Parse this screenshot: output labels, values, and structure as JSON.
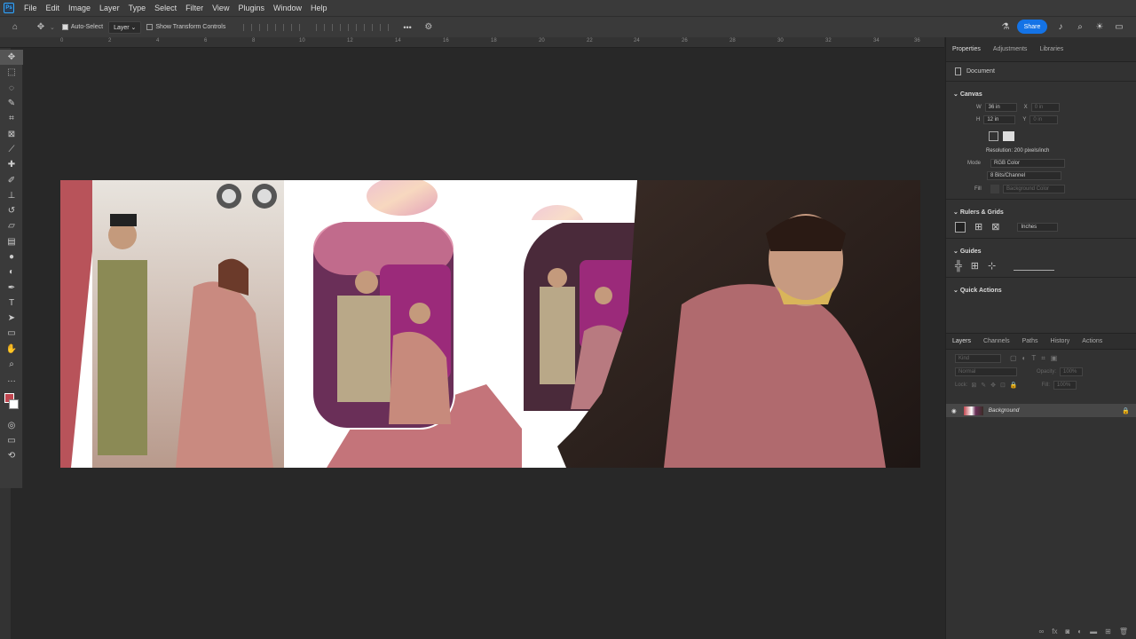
{
  "menubar": {
    "app_icon": "Ps",
    "items": [
      "File",
      "Edit",
      "Image",
      "Layer",
      "Type",
      "Select",
      "Filter",
      "View",
      "Plugins",
      "Window",
      "Help"
    ]
  },
  "options": {
    "auto_select_label": "Auto-Select",
    "auto_select_target": "Layer",
    "transform_label": "Show Transform Controls",
    "more_label": "•••",
    "share_label": "Share"
  },
  "ruler": {
    "ticks": [
      "0",
      "2",
      "4",
      "6",
      "8",
      "10",
      "12",
      "14",
      "16",
      "18",
      "20",
      "22",
      "24",
      "26",
      "28",
      "30",
      "32",
      "34",
      "36"
    ]
  },
  "panel": {
    "tabs": [
      "Properties",
      "Adjustments",
      "Libraries"
    ],
    "document_label": "Document",
    "canvas": {
      "title": "Canvas",
      "w_label": "W",
      "w_value": "36 in",
      "h_label": "H",
      "h_value": "12 in",
      "x_label": "X",
      "x_value": "0 in",
      "y_label": "Y",
      "y_value": "0 in",
      "resolution": "Resolution: 200 pixels/inch",
      "mode_label": "Mode",
      "mode_value": "RGB Color",
      "bits_value": "8 Bits/Channel",
      "fill_label": "Fill",
      "fill_value": "Background Color"
    },
    "rulers": {
      "title": "Rulers & Grids",
      "unit": "Inches"
    },
    "guides": {
      "title": "Guides"
    },
    "quick_actions": {
      "title": "Quick Actions"
    },
    "layers": {
      "tabs": [
        "Layers",
        "Channels",
        "Paths",
        "History",
        "Actions"
      ],
      "kind_label": "Kind",
      "blend_mode": "Normal",
      "opacity_label": "Opacity:",
      "opacity_value": "100%",
      "lock_label": "Lock:",
      "fill_label": "Fill:",
      "fill_value": "100%",
      "layer_name": "Background"
    }
  },
  "colors": {
    "accent": "#1473e6",
    "foreground": "#c0454f",
    "rose": "#b8535a"
  }
}
